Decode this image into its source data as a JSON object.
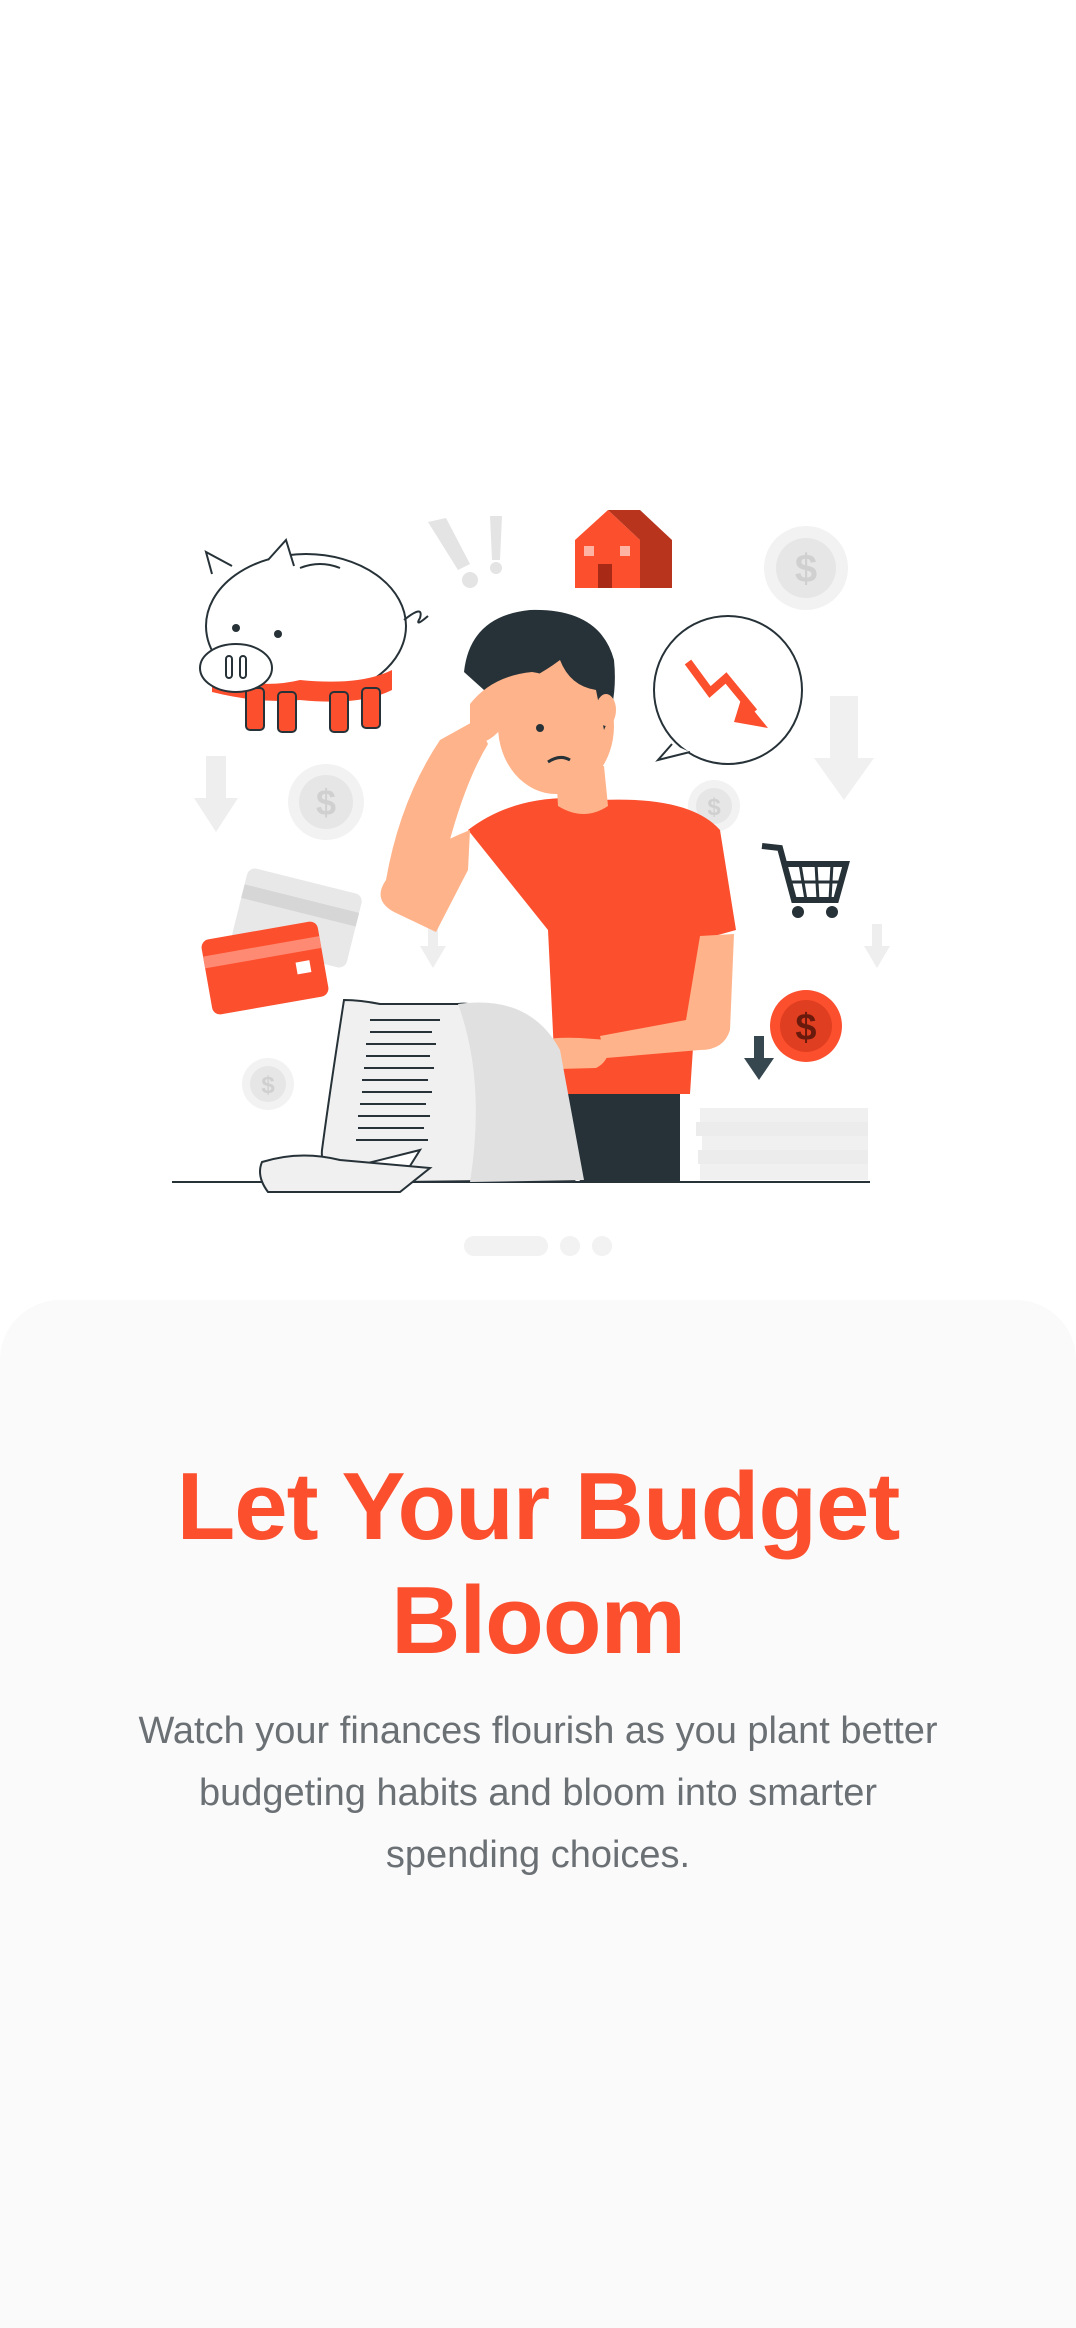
{
  "onboarding": {
    "title": "Let Your Budget Bloom",
    "subtitle": "Watch your finances flourish as you plant better budgeting habits and bloom into smarter spending choices."
  },
  "pager": {
    "page_count": 3,
    "current_page": 1
  },
  "illustration": {
    "icons": [
      "piggy-bank-icon",
      "house-icon",
      "coin-icon",
      "trend-down-icon",
      "shopping-cart-icon",
      "credit-card-icon",
      "receipt-icon",
      "arrow-down-icon",
      "exclamation-icon"
    ]
  },
  "colors": {
    "accent": "#fc4f2e",
    "text_secondary": "#6b7075",
    "sheet_background": "#fafafa",
    "background": "#ffffff"
  }
}
